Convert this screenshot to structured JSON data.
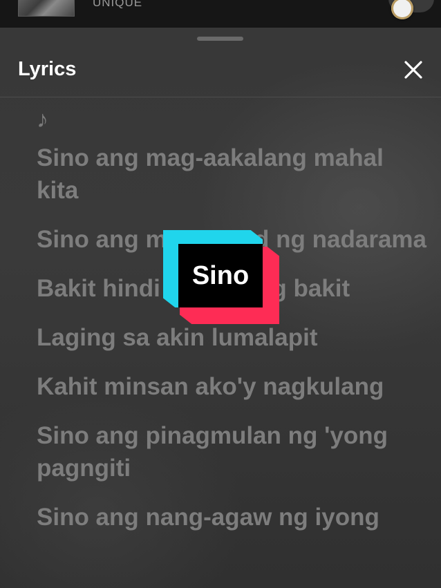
{
  "now_playing": {
    "artist": "UNIQUE"
  },
  "lyrics_sheet": {
    "title": "Lyrics",
    "close_icon": "close-icon",
    "note_symbol": "♪",
    "lines": [
      "Sino ang mag-aakalang mahal kita",
      "Sino ang m           ad ng nadarama",
      "Bakit hindi alam kung bakit",
      "Laging sa akin lumalapit",
      "Kahit minsan ako'y nagkulang",
      "Sino ang pinagmulan ng 'yong pagngiti",
      "Sino ang nang-agaw ng iyong"
    ]
  },
  "watermark": {
    "text": "Sino",
    "colors": {
      "cyan": "#20d5ec",
      "red": "#fe2c55",
      "black": "#000000"
    }
  }
}
